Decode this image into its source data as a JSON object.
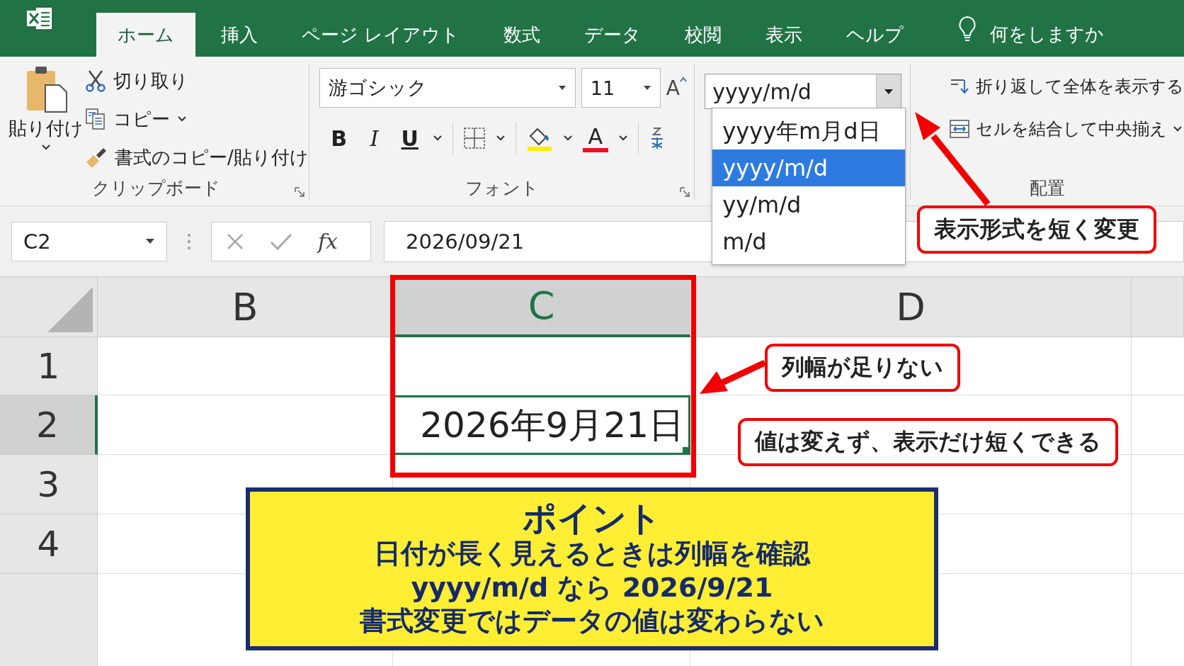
{
  "app_tabs": [
    {
      "label": "ホーム",
      "selected": true
    },
    {
      "label": "挿入",
      "selected": false
    },
    {
      "label": "ページ レイアウト",
      "selected": false
    },
    {
      "label": "数式",
      "selected": false
    },
    {
      "label": "データ",
      "selected": false
    },
    {
      "label": "校閲",
      "selected": false
    },
    {
      "label": "表示",
      "selected": false
    },
    {
      "label": "ヘルプ",
      "selected": false
    }
  ],
  "tell_me": {
    "placeholder": "何をしますか"
  },
  "clipboard": {
    "paste": "貼り付け",
    "cut": "切り取り",
    "copy": "コピー",
    "format_painter": "書式のコピー/貼り付け",
    "group_label": "クリップボード"
  },
  "font": {
    "name": "游ゴシック",
    "size": "11",
    "grow": "A",
    "bold": "B",
    "italic": "I",
    "underline": "U",
    "font_color": "A",
    "group_label": "フォント"
  },
  "number_format": {
    "value": "yyyy/m/d",
    "expanded": true,
    "options": [
      {
        "label": "yyyy年m月d日",
        "selected": false
      },
      {
        "label": "yyyy/m/d",
        "selected": true
      },
      {
        "label": "yy/m/d",
        "selected": false
      },
      {
        "label": "m/d",
        "selected": false
      }
    ]
  },
  "alignment": {
    "wrap": "折り返して全体を表示する",
    "merge": "セルを結合して中央揃え",
    "group_label": "配置"
  },
  "formula_bar": {
    "name_box": "C2",
    "fx": "fx",
    "formula": "2026/09/21"
  },
  "sheet": {
    "columns": [
      {
        "label": "B",
        "selected": false
      },
      {
        "label": "C",
        "selected": true
      },
      {
        "label": "D",
        "selected": false
      }
    ],
    "rows": [
      {
        "label": "1",
        "selected": false
      },
      {
        "label": "2",
        "selected": true,
        "active_cell": {
          "value": "2026年9月21日",
          "selected": true
        }
      },
      {
        "label": "3",
        "selected": false
      },
      {
        "label": "4",
        "selected": false
      }
    ]
  },
  "callouts": [
    {
      "kind": "format",
      "text": "表示形式を短く変更"
    },
    {
      "kind": "width",
      "text": "列幅が足りない"
    },
    {
      "kind": "value",
      "text": "値は変えず、表示だけ短くできる"
    }
  ],
  "point": {
    "title": "ポイント",
    "lines": [
      "日付が長く見えるときは列幅を確認",
      "yyyy/m/d なら 2026/9/21",
      "書式変更ではデータの値は変わらない"
    ]
  }
}
